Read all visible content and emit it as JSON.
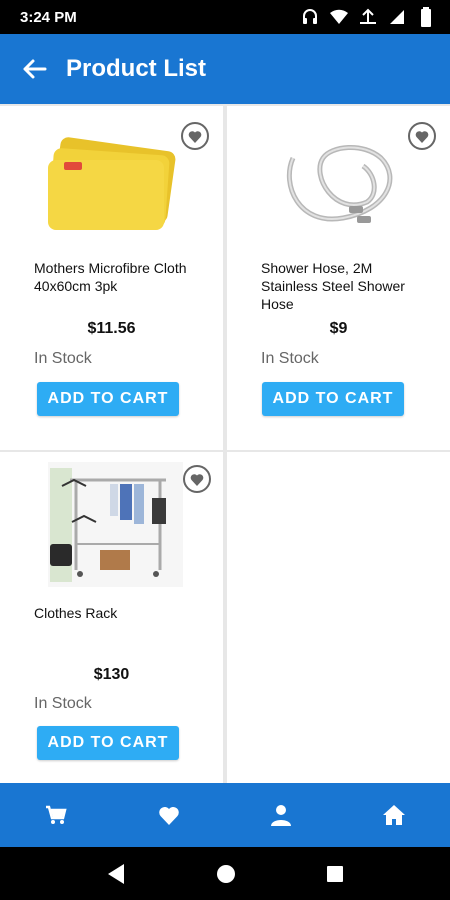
{
  "status_bar": {
    "time": "3:24 PM",
    "icons": [
      "headset-icon",
      "wifi-icon",
      "network-icon",
      "signal-icon",
      "battery-icon"
    ]
  },
  "app_bar": {
    "title": "Product List",
    "back_icon": "arrow-left-icon",
    "background": "#1976d2"
  },
  "products": [
    {
      "name": "Mothers Microfibre Cloth 40x60cm 3pk",
      "price": "$11.56",
      "stock": "In Stock",
      "button": "ADD TO CART",
      "image": "yellow-microfibre-cloth"
    },
    {
      "name": "Shower Hose, 2M Stainless Steel Shower Hose",
      "price": "$9",
      "stock": "In Stock",
      "button": "ADD TO CART",
      "image": "steel-shower-hose"
    },
    {
      "name": "Clothes Rack",
      "price": "$130",
      "stock": "In Stock",
      "button": "ADD TO CART",
      "image": "clothes-rack"
    }
  ],
  "bottom_nav": {
    "items": [
      "cart-icon",
      "heart-icon",
      "person-icon",
      "home-icon"
    ]
  },
  "system_nav": {
    "items": [
      "back-triangle-icon",
      "home-circle-icon",
      "recents-square-icon"
    ]
  },
  "colors": {
    "primary": "#1976d2",
    "button": "#2eacf4",
    "stock_text": "#666666"
  }
}
